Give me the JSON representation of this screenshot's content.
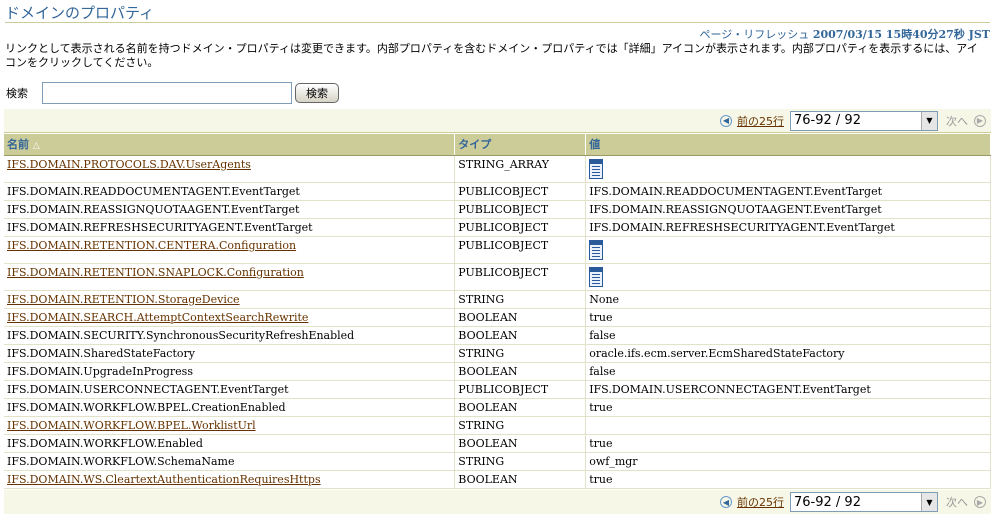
{
  "page": {
    "title": "ドメインのプロパティ",
    "refresh_label": "ページ・リフレッシュ",
    "refresh_time": "2007/03/15 15時40分27秒 JST",
    "instructions": "リンクとして表示される名前を持つドメイン・プロパティは変更できます。内部プロパティを含むドメイン・プロパティでは「詳細」アイコンが表示されます。内部プロパティを表示するには、アイコンをクリックしてください。"
  },
  "search": {
    "label": "検索",
    "value": "",
    "button": "検索"
  },
  "nav": {
    "prev_label": "前の25行",
    "range": "76-92 / 92",
    "next_label": "次へ"
  },
  "table": {
    "headers": {
      "name": "名前",
      "type": "タイプ",
      "value": "値"
    },
    "rows": [
      {
        "name": "IFS.DOMAIN.PROTOCOLS.DAV.UserAgents",
        "link": true,
        "type": "STRING_ARRAY",
        "value": "",
        "icon": "details-icon"
      },
      {
        "name": "IFS.DOMAIN.READDOCUMENTAGENT.EventTarget",
        "link": false,
        "type": "PUBLICOBJECT",
        "value": "IFS.DOMAIN.READDOCUMENTAGENT.EventTarget"
      },
      {
        "name": "IFS.DOMAIN.REASSIGNQUOTAAGENT.EventTarget",
        "link": false,
        "type": "PUBLICOBJECT",
        "value": "IFS.DOMAIN.REASSIGNQUOTAAGENT.EventTarget"
      },
      {
        "name": "IFS.DOMAIN.REFRESHSECURITYAGENT.EventTarget",
        "link": false,
        "type": "PUBLICOBJECT",
        "value": "IFS.DOMAIN.REFRESHSECURITYAGENT.EventTarget"
      },
      {
        "name": "IFS.DOMAIN.RETENTION.CENTERA.Configuration",
        "link": true,
        "type": "PUBLICOBJECT",
        "value": "",
        "icon": "details-icon"
      },
      {
        "name": "IFS.DOMAIN.RETENTION.SNAPLOCK.Configuration",
        "link": true,
        "type": "PUBLICOBJECT",
        "value": "",
        "icon": "details-icon"
      },
      {
        "name": "IFS.DOMAIN.RETENTION.StorageDevice",
        "link": true,
        "type": "STRING",
        "value": "None"
      },
      {
        "name": "IFS.DOMAIN.SEARCH.AttemptContextSearchRewrite",
        "link": true,
        "type": "BOOLEAN",
        "value": "true"
      },
      {
        "name": "IFS.DOMAIN.SECURITY.SynchronousSecurityRefreshEnabled",
        "link": false,
        "type": "BOOLEAN",
        "value": "false"
      },
      {
        "name": "IFS.DOMAIN.SharedStateFactory",
        "link": false,
        "type": "STRING",
        "value": "oracle.ifs.ecm.server.EcmSharedStateFactory"
      },
      {
        "name": "IFS.DOMAIN.UpgradeInProgress",
        "link": false,
        "type": "BOOLEAN",
        "value": "false"
      },
      {
        "name": "IFS.DOMAIN.USERCONNECTAGENT.EventTarget",
        "link": false,
        "type": "PUBLICOBJECT",
        "value": "IFS.DOMAIN.USERCONNECTAGENT.EventTarget"
      },
      {
        "name": "IFS.DOMAIN.WORKFLOW.BPEL.CreationEnabled",
        "link": false,
        "type": "BOOLEAN",
        "value": "true"
      },
      {
        "name": "IFS.DOMAIN.WORKFLOW.BPEL.WorklistUrl",
        "link": true,
        "type": "STRING",
        "value": ""
      },
      {
        "name": "IFS.DOMAIN.WORKFLOW.Enabled",
        "link": false,
        "type": "BOOLEAN",
        "value": "true"
      },
      {
        "name": "IFS.DOMAIN.WORKFLOW.SchemaName",
        "link": false,
        "type": "STRING",
        "value": "owf_mgr"
      },
      {
        "name": "IFS.DOMAIN.WS.CleartextAuthenticationRequiresHttps",
        "link": true,
        "type": "BOOLEAN",
        "value": "true"
      }
    ]
  },
  "colors": {
    "header_bg": "#cccc99",
    "link": "#663300",
    "title": "#336699"
  }
}
